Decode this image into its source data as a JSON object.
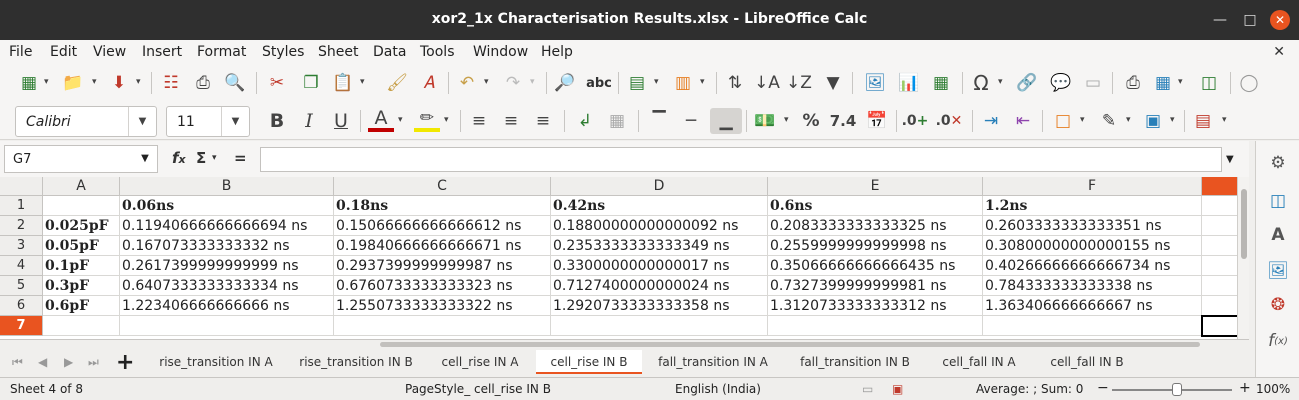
{
  "window": {
    "title": "xor2_1x Characterisation Results.xlsx - LibreOffice Calc"
  },
  "menu": [
    "File",
    "Edit",
    "View",
    "Insert",
    "Format",
    "Styles",
    "Sheet",
    "Data",
    "Tools",
    "Window",
    "Help"
  ],
  "format": {
    "font_name": "Calibri",
    "font_size": "11"
  },
  "formula_bar": {
    "cell_ref": "G7",
    "formula": ""
  },
  "grid": {
    "columns": [
      "A",
      "B",
      "C",
      "D",
      "E",
      "F"
    ],
    "rows": [
      "1",
      "2",
      "3",
      "4",
      "5",
      "6",
      "7"
    ],
    "active_row": "7",
    "active_cell": "G7",
    "header_row": [
      "",
      "0.06ns",
      "0.18ns",
      "0.42ns",
      "0.6ns",
      "1.2ns"
    ],
    "data": [
      [
        "0.025pF",
        "0.11940666666666694 ns",
        "0.15066666666666612 ns",
        "0.18800000000000092 ns",
        "0.2083333333333325 ns",
        "0.2603333333333351 ns"
      ],
      [
        "0.05pF",
        "0.167073333333332 ns",
        "0.19840666666666671 ns",
        "0.2353333333333349 ns",
        "0.2559999999999998 ns",
        "0.30800000000000155 ns"
      ],
      [
        "0.1pF",
        "0.2617399999999999 ns",
        "0.2937399999999987 ns",
        "0.3300000000000017 ns",
        "0.35066666666666435 ns",
        "0.40266666666666734 ns"
      ],
      [
        "0.3pF",
        "0.6407333333333334 ns",
        "0.6760733333333323 ns",
        "0.7127400000000024 ns",
        "0.7327399999999981 ns",
        "0.784333333333338 ns"
      ],
      [
        "0.6pF",
        "1.223406666666666 ns",
        "1.2550733333333322 ns",
        "1.2920733333333358 ns",
        "1.3120733333333312 ns",
        "1.363406666666667 ns"
      ]
    ]
  },
  "sheet_tabs": [
    "rise_transition   IN A",
    "rise_transition   IN B",
    "cell_rise   IN A",
    "cell_rise   IN B",
    "fall_transition   IN A",
    "fall_transition   IN B",
    "cell_fall   IN A",
    "cell_fall   IN B"
  ],
  "active_tab_index": 3,
  "status": {
    "sheet": "Sheet 4 of 8",
    "page_style": "PageStyle_ cell_rise   IN B",
    "language": "English (India)",
    "sum": "Average: ; Sum: 0",
    "zoom": "100%",
    "zoom_minus": "−",
    "zoom_plus": "+"
  },
  "colors": {
    "accent": "#e95420",
    "titlebar": "#2f2f2f"
  }
}
